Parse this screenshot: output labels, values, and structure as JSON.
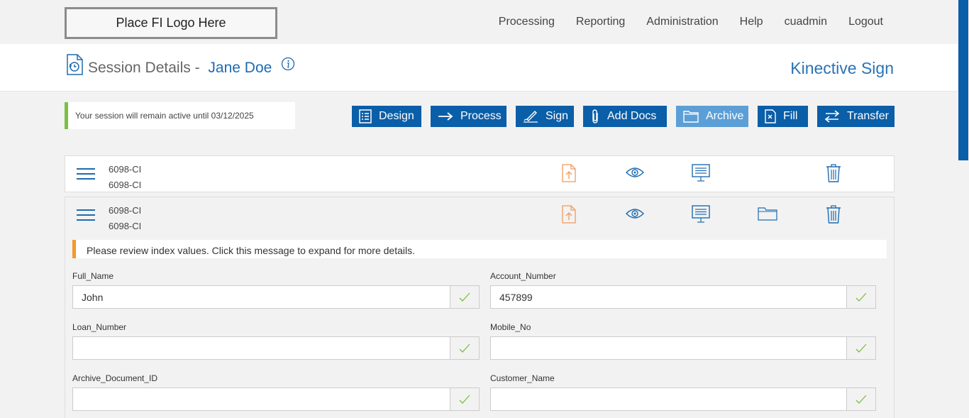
{
  "logo": {
    "text": "Place FI Logo Here"
  },
  "nav": [
    "Processing",
    "Reporting",
    "Administration",
    "Help",
    "cuadmin",
    "Logout"
  ],
  "header": {
    "title": "Session Details -",
    "name": "Jane Doe",
    "brand": "Kinective Sign"
  },
  "session_notice": "Your session will remain active until 03/12/2025",
  "toolbar": {
    "design": "Design",
    "process": "Process",
    "sign": "Sign",
    "add_docs": "Add Docs",
    "archive": "Archive",
    "fill": "Fill",
    "transfer": "Transfer"
  },
  "documents": [
    {
      "line1": "6098-CI",
      "line2": "6098-CI"
    },
    {
      "line1": "6098-CI",
      "line2": "6098-CI"
    }
  ],
  "alert": "Please review index values. Click this message to expand for more details.",
  "fields": {
    "full_name": {
      "label": "Full_Name",
      "value": "John"
    },
    "account_number": {
      "label": "Account_Number",
      "value": "457899"
    },
    "loan_number": {
      "label": "Loan_Number",
      "value": ""
    },
    "mobile_no": {
      "label": "Mobile_No",
      "value": ""
    },
    "archive_document_id": {
      "label": "Archive_Document_ID",
      "value": ""
    },
    "customer_name": {
      "label": "Customer_Name",
      "value": ""
    }
  },
  "colors": {
    "primary": "#0b5ea8",
    "active": "#5b9fd6",
    "success": "#7ac143",
    "warning": "#f29a2e",
    "upload_icon": "#f29a5a"
  }
}
